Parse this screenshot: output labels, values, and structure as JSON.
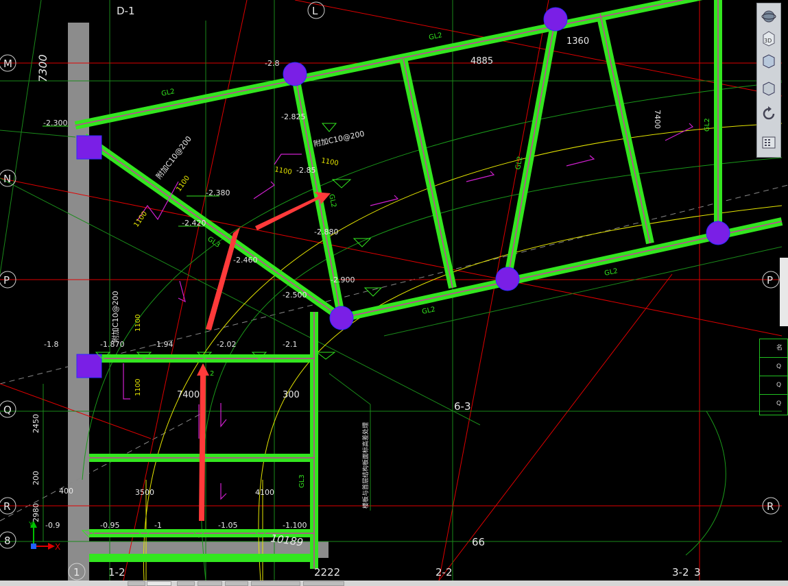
{
  "axes": {
    "D1": "D-1",
    "L": "L",
    "M": "M",
    "N": "N",
    "P": "P",
    "Q": "Q",
    "R": "R",
    "R8": "8",
    "P_right": "P",
    "R_right": "R",
    "c1": "1",
    "c1_2": "1-2",
    "c2222": "2222",
    "c2_2": "2-2",
    "c3_2": "3-2",
    "c3": "3",
    "c6_3": "6-3",
    "c66": "66"
  },
  "elevations": {
    "e1": "-2.300",
    "e2": "-2.8",
    "e3": "-2.825",
    "e4": "-2.85",
    "e5": "-2.380",
    "e6": "-2.420",
    "e7": "-2.880",
    "e8": "-2.460",
    "e9": "-2.900",
    "e10": "-2.500",
    "e11": "-1.8",
    "e12": "-1.870",
    "e13": "-1.94",
    "e14": "-2.02",
    "e15": "-2.1",
    "e16": "-0.9",
    "e17": "-0.95",
    "e18": "-1",
    "e19": "-1.05",
    "e20": "-1.100"
  },
  "dimensions": {
    "d7300": "7300",
    "d4885": "4885",
    "d1360": "1360",
    "d7400v": "7400",
    "d7400": "7400",
    "d300": "300",
    "d2450": "2450",
    "d200": "200",
    "d400": "400",
    "d3500": "3500",
    "d4100": "4100",
    "d2980": "2980",
    "d10189": "10189",
    "d1100a": "1100",
    "d1100b": "1100",
    "d1100c": "1100",
    "d1100d": "1100",
    "d1100e": "1100",
    "d1100f": "1100",
    "d1100g": "1100"
  },
  "beam_labels": {
    "gl2a": "GL2",
    "gl2b": "GL2",
    "gl2c": "GL2",
    "gl2d": "GL2",
    "gl2e": "GL2",
    "gl2f": "GL2",
    "gl2g": "GL2",
    "gl2h": "GL2",
    "gl3a": "GL3",
    "gl3b": "GL3",
    "b2": "2"
  },
  "annotations": {
    "rebar1": "附加C10@200",
    "rebar2": "附加C10@200",
    "rebar3": "附加C10@200",
    "note": "楼板与首层结构板面标高差处理",
    "ucs_x": "X",
    "ucs_y": "Y"
  },
  "toolbar": {
    "btn_3d": "3D"
  },
  "right_panel": {
    "r1": "名",
    "r2": "Q",
    "r3": "Q",
    "r4": "Q"
  },
  "colors": {
    "beam": "#33e61f",
    "red_grid": "#e00000",
    "column": "#7a1fe6",
    "arrow": "#ff3333",
    "yellow": "#e6e600",
    "magenta": "#d020d0"
  }
}
